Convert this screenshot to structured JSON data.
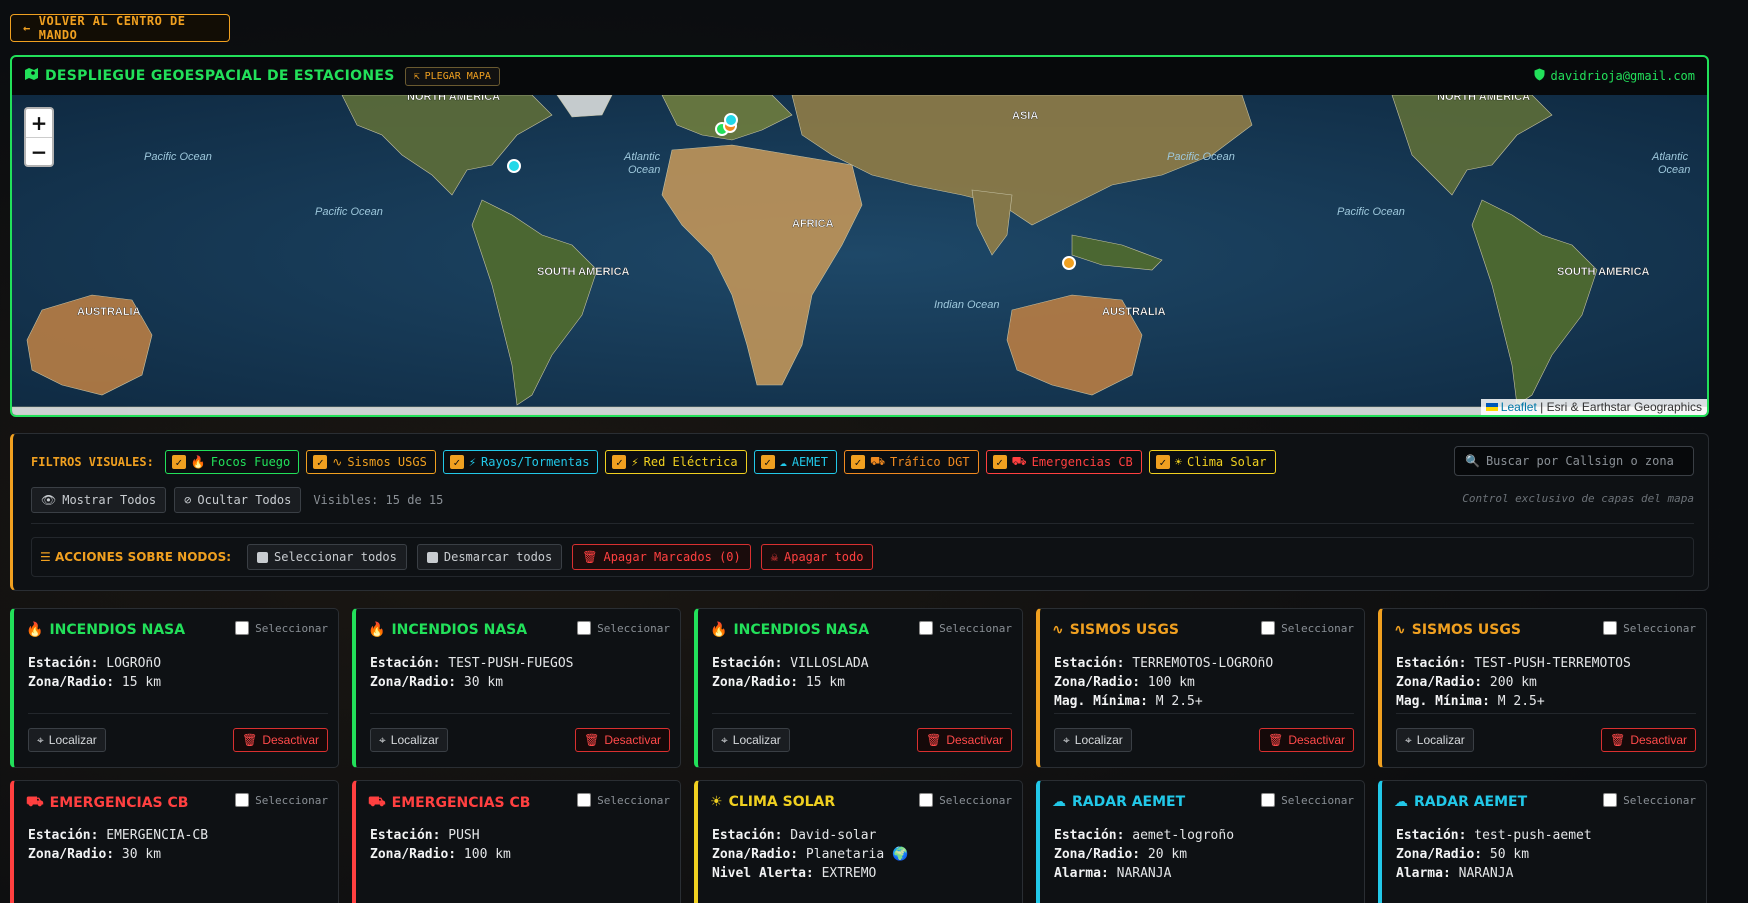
{
  "back_button": {
    "label": "VOLVER AL CENTRO DE MANDO",
    "icon": "arrow-left-icon"
  },
  "map": {
    "title": "DESPLIEGUE GEOESPACIAL DE ESTACIONES",
    "fold_label": "PLEGAR MAPA",
    "user_email": "davidrioja@gmail.com",
    "zoom_in": "+",
    "zoom_out": "−",
    "attribution_link": "Leaflet",
    "attribution_text": "| Esri & Earthstar Geographics",
    "place_labels": [
      "NORTH AMERICA",
      "ASIA",
      "AFRICA",
      "SOUTH AMERICA",
      "AUSTRALIA",
      "Pacific Ocean",
      "Atlantic Ocean",
      "Indian Ocean"
    ]
  },
  "filters": {
    "label": "FILTROS VISUALES:",
    "chips": [
      {
        "label": "Focos Fuego",
        "color": "#22e05a",
        "icon": "fire-icon"
      },
      {
        "label": "Sismos USGS",
        "color": "#f0a020",
        "icon": "seismic-wave-icon"
      },
      {
        "label": "Rayos/Tormentas",
        "color": "#22c8e8",
        "icon": "lightning-icon"
      },
      {
        "label": "Red Eléctrica",
        "color": "#f0d020",
        "icon": "bolt-icon"
      },
      {
        "label": "AEMET",
        "color": "#22c8e8",
        "icon": "cloud-rain-icon"
      },
      {
        "label": "Tráfico DGT",
        "color": "#f08a20",
        "icon": "car-crash-icon"
      },
      {
        "label": "Emergencias CB",
        "color": "#ff4040",
        "icon": "ambulance-icon"
      },
      {
        "label": "Clima Solar",
        "color": "#f0d020",
        "icon": "sun-icon"
      }
    ],
    "search_placeholder": "Buscar por Callsign o zona...",
    "show_all": "Mostrar Todos",
    "hide_all": "Ocultar Todos",
    "visible_count": "Visibles: 15 de 15",
    "note": "Control exclusivo de capas del mapa"
  },
  "actions": {
    "label": "ACCIONES SOBRE NODOS:",
    "select_all": "Seleccionar todos",
    "deselect_all": "Desmarcar todos",
    "power_off_marked": "Apagar Marcados (0)",
    "power_off_all": "Apagar todo"
  },
  "card_ui": {
    "select_label": "Seleccionar",
    "locate_label": "Localizar",
    "deactivate_label": "Desactivar"
  },
  "cards": [
    {
      "title": "INCENDIOS NASA",
      "color": "#22e05a",
      "icon": "fire-icon",
      "lines": [
        [
          "Estación:",
          "LOGROñO"
        ],
        [
          "Zona/Radio:",
          "15 km"
        ]
      ]
    },
    {
      "title": "INCENDIOS NASA",
      "color": "#22e05a",
      "icon": "fire-icon",
      "lines": [
        [
          "Estación:",
          "TEST-PUSH-FUEGOS"
        ],
        [
          "Zona/Radio:",
          "30 km"
        ]
      ]
    },
    {
      "title": "INCENDIOS NASA",
      "color": "#22e05a",
      "icon": "fire-icon",
      "lines": [
        [
          "Estación:",
          "VILLOSLADA"
        ],
        [
          "Zona/Radio:",
          "15 km"
        ]
      ]
    },
    {
      "title": "SISMOS USGS",
      "color": "#f0a020",
      "icon": "seismic-wave-icon",
      "lines": [
        [
          "Estación:",
          "TERREMOTOS-LOGROñO"
        ],
        [
          "Zona/Radio:",
          "100 km"
        ],
        [
          "Mag. Mínima:",
          "M 2.5+"
        ]
      ]
    },
    {
      "title": "SISMOS USGS",
      "color": "#f0a020",
      "icon": "seismic-wave-icon",
      "lines": [
        [
          "Estación:",
          "TEST-PUSH-TERREMOTOS"
        ],
        [
          "Zona/Radio:",
          "200 km"
        ],
        [
          "Mag. Mínima:",
          "M 2.5+"
        ]
      ]
    },
    {
      "title": "EMERGENCIAS CB",
      "color": "#ff4040",
      "icon": "ambulance-icon",
      "lines": [
        [
          "Estación:",
          "EMERGENCIA-CB"
        ],
        [
          "Zona/Radio:",
          "30 km"
        ]
      ]
    },
    {
      "title": "EMERGENCIAS CB",
      "color": "#ff4040",
      "icon": "ambulance-icon",
      "lines": [
        [
          "Estación:",
          "PUSH"
        ],
        [
          "Zona/Radio:",
          "100 km"
        ]
      ]
    },
    {
      "title": "CLIMA SOLAR",
      "color": "#f0d020",
      "icon": "sun-icon",
      "lines": [
        [
          "Estación:",
          "David-solar"
        ],
        [
          "Zona/Radio:",
          "Planetaria 🌍"
        ],
        [
          "Nivel Alerta:",
          "EXTREMO"
        ]
      ]
    },
    {
      "title": "RADAR AEMET",
      "color": "#22c8e8",
      "icon": "cloud-rain-icon",
      "lines": [
        [
          "Estación:",
          "aemet-logroño"
        ],
        [
          "Zona/Radio:",
          "20 km"
        ],
        [
          "Alarma:",
          "NARANJA"
        ]
      ]
    },
    {
      "title": "RADAR AEMET",
      "color": "#22c8e8",
      "icon": "cloud-rain-icon",
      "lines": [
        [
          "Estación:",
          "test-push-aemet"
        ],
        [
          "Zona/Radio:",
          "50 km"
        ],
        [
          "Alarma:",
          "NARANJA"
        ]
      ]
    }
  ]
}
